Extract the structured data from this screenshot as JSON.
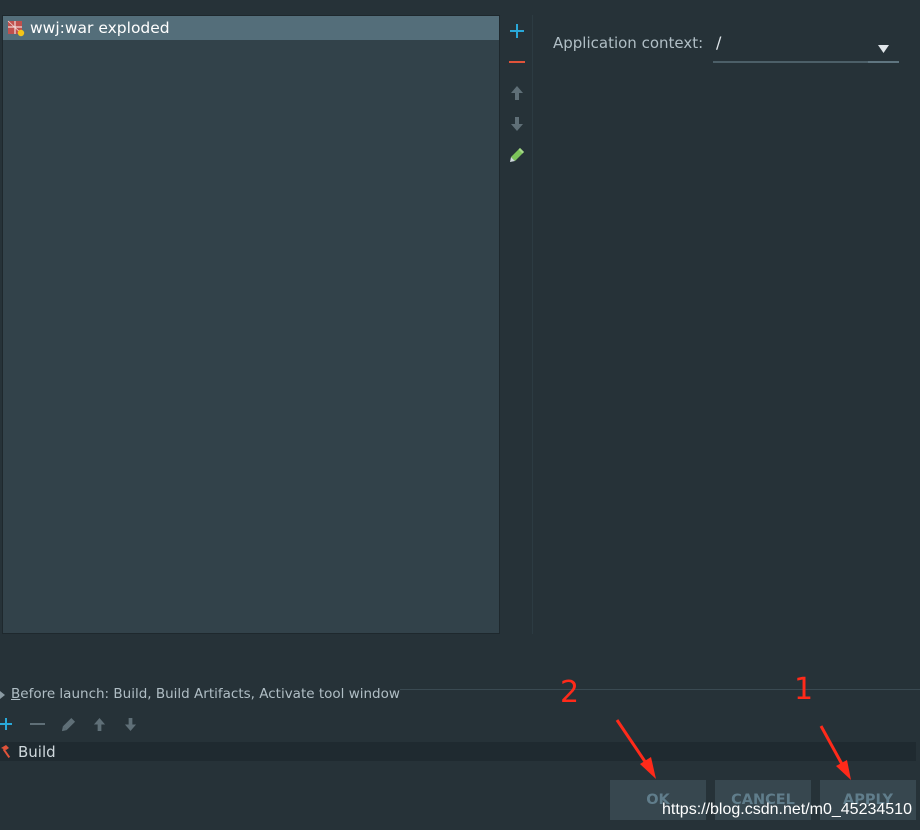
{
  "deployment": {
    "artifacts": [
      {
        "label": "wwj:war exploded",
        "icon": "war-exploded-icon"
      }
    ],
    "toolbar": {
      "add_icon": "plus-icon",
      "remove_icon": "minus-icon",
      "move_up_icon": "arrow-up-icon",
      "move_down_icon": "arrow-down-icon",
      "edit_icon": "pencil-icon"
    }
  },
  "context": {
    "label": "Application context:",
    "value": "/"
  },
  "before_launch": {
    "title_mnemonic": "B",
    "title_rest": "efore launch: Build, Build Artifacts, Activate tool window",
    "tasks": [
      {
        "label": "Build",
        "icon": "hammer-icon"
      }
    ]
  },
  "dialog": {
    "ok_label": "OK",
    "cancel_label": "CANCEL",
    "apply_label": "APPLY"
  },
  "annotations": {
    "step_2": "2",
    "step_1": "1"
  },
  "watermark": "https://blog.csdn.net/m0_45234510",
  "colors": {
    "accent_add": "#29a8d8",
    "accent_remove": "#e0533a",
    "annotation": "#ff2a1a",
    "selection": "#546e7a"
  }
}
